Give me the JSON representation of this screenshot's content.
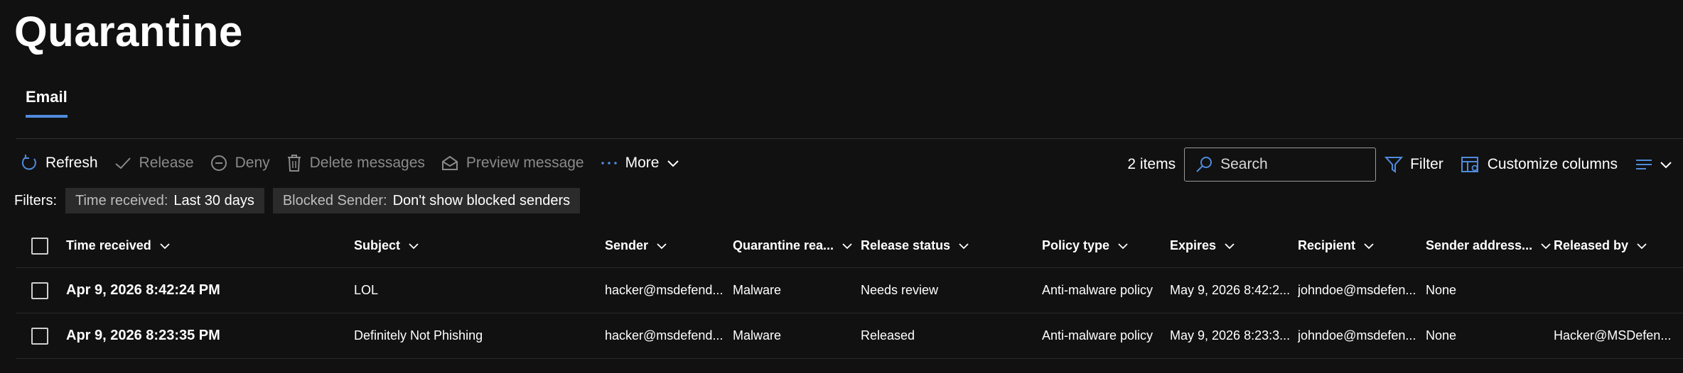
{
  "page": {
    "title": "Quarantine"
  },
  "tabs": [
    {
      "label": "Email",
      "active": true
    }
  ],
  "toolbar": {
    "refresh": "Refresh",
    "release": "Release",
    "deny": "Deny",
    "delete": "Delete messages",
    "preview": "Preview message",
    "more": "More"
  },
  "toolbar_right": {
    "items_count": "2 items",
    "search_placeholder": "Search",
    "filter": "Filter",
    "customize": "Customize columns"
  },
  "filters": {
    "label": "Filters:",
    "chips": [
      {
        "key": "Time received:",
        "value": "Last 30 days"
      },
      {
        "key": "Blocked Sender:",
        "value": "Don't show blocked senders"
      }
    ]
  },
  "table": {
    "columns": [
      "Time received",
      "Subject",
      "Sender",
      "Quarantine rea...",
      "Release status",
      "Policy type",
      "Expires",
      "Recipient",
      "Sender address...",
      "Released by"
    ],
    "rows": [
      {
        "time": "Apr 9, 2026 8:42:24 PM",
        "subject": "LOL",
        "sender": "hacker@msdefend...",
        "reason": "Malware",
        "status": "Needs review",
        "policy": "Anti-malware policy",
        "expires": "May 9, 2026 8:42:2...",
        "recipient": "johndoe@msdefen...",
        "sender_address": "None",
        "released_by": ""
      },
      {
        "time": "Apr 9, 2026 8:23:35 PM",
        "subject": "Definitely Not Phishing",
        "sender": "hacker@msdefend...",
        "reason": "Malware",
        "status": "Released",
        "policy": "Anti-malware policy",
        "expires": "May 9, 2026 8:23:3...",
        "recipient": "johndoe@msdefen...",
        "sender_address": "None",
        "released_by": "Hacker@MSDefen..."
      }
    ]
  },
  "colors": {
    "background": "#111111",
    "accent": "#4f8bdc",
    "disabled": "#8a8a8a"
  }
}
